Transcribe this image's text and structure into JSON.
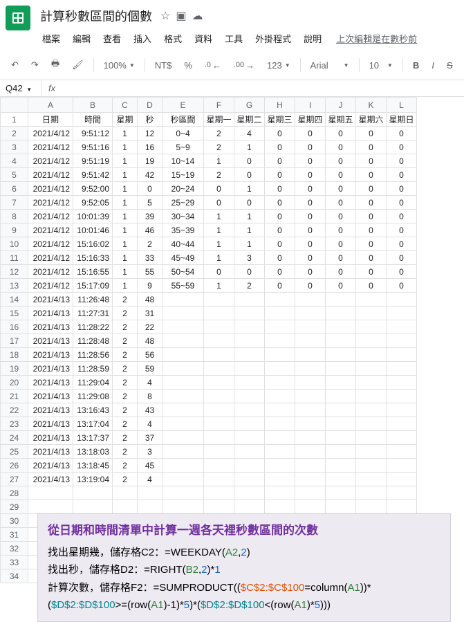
{
  "doc_title": "計算秒數區間的個數",
  "menus": [
    "檔案",
    "編輯",
    "查看",
    "插入",
    "格式",
    "資料",
    "工具",
    "外掛程式",
    "說明"
  ],
  "last_edit": "上次編輯是在數秒前",
  "toolbar": {
    "zoom": "100%",
    "currency": "NT$",
    "percent": "%",
    "dec_dec": ".0",
    "dec_inc": ".00",
    "num_fmt": "123",
    "font": "Arial",
    "size": "10"
  },
  "name_box": "Q42",
  "columns": [
    "A",
    "B",
    "C",
    "D",
    "E",
    "F",
    "G",
    "H",
    "I",
    "J",
    "K",
    "L"
  ],
  "header_row": [
    "日期",
    "時間",
    "星期",
    "秒",
    "秒區間",
    "星期一",
    "星期二",
    "星期三",
    "星期四",
    "星期五",
    "星期六",
    "星期日"
  ],
  "rows": [
    [
      "2021/4/12",
      "9:51:12",
      "1",
      "12",
      "0~4",
      "2",
      "4",
      "0",
      "0",
      "0",
      "0",
      "0"
    ],
    [
      "2021/4/12",
      "9:51:16",
      "1",
      "16",
      "5~9",
      "2",
      "1",
      "0",
      "0",
      "0",
      "0",
      "0"
    ],
    [
      "2021/4/12",
      "9:51:19",
      "1",
      "19",
      "10~14",
      "1",
      "0",
      "0",
      "0",
      "0",
      "0",
      "0"
    ],
    [
      "2021/4/12",
      "9:51:42",
      "1",
      "42",
      "15~19",
      "2",
      "0",
      "0",
      "0",
      "0",
      "0",
      "0"
    ],
    [
      "2021/4/12",
      "9:52:00",
      "1",
      "0",
      "20~24",
      "0",
      "1",
      "0",
      "0",
      "0",
      "0",
      "0"
    ],
    [
      "2021/4/12",
      "9:52:05",
      "1",
      "5",
      "25~29",
      "0",
      "0",
      "0",
      "0",
      "0",
      "0",
      "0"
    ],
    [
      "2021/4/12",
      "10:01:39",
      "1",
      "39",
      "30~34",
      "1",
      "1",
      "0",
      "0",
      "0",
      "0",
      "0"
    ],
    [
      "2021/4/12",
      "10:01:46",
      "1",
      "46",
      "35~39",
      "1",
      "1",
      "0",
      "0",
      "0",
      "0",
      "0"
    ],
    [
      "2021/4/12",
      "15:16:02",
      "1",
      "2",
      "40~44",
      "1",
      "1",
      "0",
      "0",
      "0",
      "0",
      "0"
    ],
    [
      "2021/4/12",
      "15:16:33",
      "1",
      "33",
      "45~49",
      "1",
      "3",
      "0",
      "0",
      "0",
      "0",
      "0"
    ],
    [
      "2021/4/12",
      "15:16:55",
      "1",
      "55",
      "50~54",
      "0",
      "0",
      "0",
      "0",
      "0",
      "0",
      "0"
    ],
    [
      "2021/4/12",
      "15:17:09",
      "1",
      "9",
      "55~59",
      "1",
      "2",
      "0",
      "0",
      "0",
      "0",
      "0"
    ],
    [
      "2021/4/13",
      "11:26:48",
      "2",
      "48",
      "",
      "",
      "",
      "",
      "",
      "",
      "",
      ""
    ],
    [
      "2021/4/13",
      "11:27:31",
      "2",
      "31",
      "",
      "",
      "",
      "",
      "",
      "",
      "",
      ""
    ],
    [
      "2021/4/13",
      "11:28:22",
      "2",
      "22",
      "",
      "",
      "",
      "",
      "",
      "",
      "",
      ""
    ],
    [
      "2021/4/13",
      "11:28:48",
      "2",
      "48",
      "",
      "",
      "",
      "",
      "",
      "",
      "",
      ""
    ],
    [
      "2021/4/13",
      "11:28:56",
      "2",
      "56",
      "",
      "",
      "",
      "",
      "",
      "",
      "",
      ""
    ],
    [
      "2021/4/13",
      "11:28:59",
      "2",
      "59",
      "",
      "",
      "",
      "",
      "",
      "",
      "",
      ""
    ],
    [
      "2021/4/13",
      "11:29:04",
      "2",
      "4",
      "",
      "",
      "",
      "",
      "",
      "",
      "",
      ""
    ],
    [
      "2021/4/13",
      "11:29:08",
      "2",
      "8",
      "",
      "",
      "",
      "",
      "",
      "",
      "",
      ""
    ],
    [
      "2021/4/13",
      "13:16:43",
      "2",
      "43",
      "",
      "",
      "",
      "",
      "",
      "",
      "",
      ""
    ],
    [
      "2021/4/13",
      "13:17:04",
      "2",
      "4",
      "",
      "",
      "",
      "",
      "",
      "",
      "",
      ""
    ],
    [
      "2021/4/13",
      "13:17:37",
      "2",
      "37",
      "",
      "",
      "",
      "",
      "",
      "",
      "",
      ""
    ],
    [
      "2021/4/13",
      "13:18:03",
      "2",
      "3",
      "",
      "",
      "",
      "",
      "",
      "",
      "",
      ""
    ],
    [
      "2021/4/13",
      "13:18:45",
      "2",
      "45",
      "",
      "",
      "",
      "",
      "",
      "",
      "",
      ""
    ],
    [
      "2021/4/13",
      "13:19:04",
      "2",
      "4",
      "",
      "",
      "",
      "",
      "",
      "",
      "",
      ""
    ]
  ],
  "info": {
    "title": "從日期和時間清單中計算一週各天裡秒數區間的次數",
    "line1_a": "找出星期幾，儲存格C2：=WEEKDAY(",
    "line1_b": "A2",
    "line1_c": ",",
    "line1_d": "2",
    "line1_e": ")",
    "line2_a": "找出秒，儲存格D2：=RIGHT(",
    "line2_b": "B2",
    "line2_c": ",",
    "line2_d": "2",
    "line2_e": ")*",
    "line2_f": "1",
    "line3_a": "計算次數，儲存格F2：=SUMPRODUCT((",
    "line3_b": "$C$2:$C$100",
    "line3_c": "=column(",
    "line3_d": "A1",
    "line3_e": "))*",
    "line4_a": "(",
    "line4_b": "$D$2:$D$100",
    "line4_c": ">=(row(",
    "line4_d": "A1",
    "line4_e": ")-1)*",
    "line4_f": "5",
    "line4_g": ")*(",
    "line4_h": "$D$2:$D$100",
    "line4_i": "<(row(",
    "line4_j": "A1",
    "line4_k": ")*",
    "line4_l": "5",
    "line4_m": ")))"
  }
}
